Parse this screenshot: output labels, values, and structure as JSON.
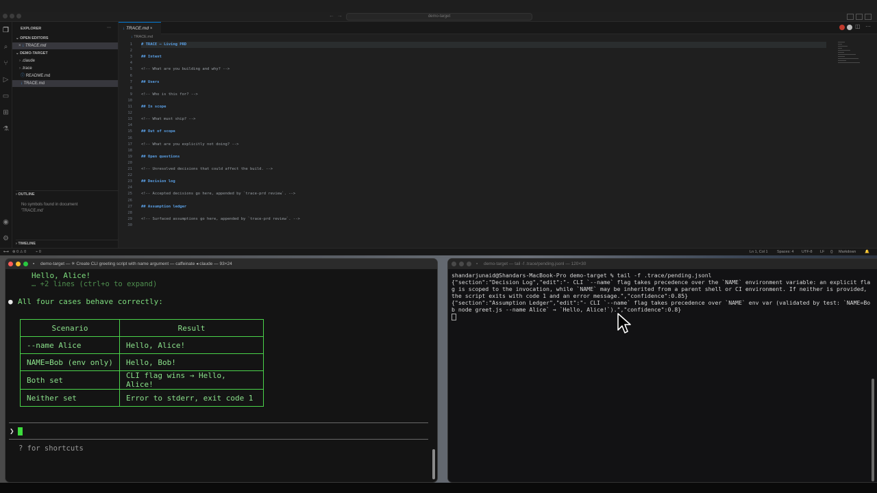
{
  "vscode": {
    "search_label": "demo-target",
    "activity_icons": [
      "files-icon",
      "search-icon",
      "source-control-icon",
      "run-debug-icon",
      "remote-explorer-icon",
      "extensions-icon",
      "testing-icon",
      "account-icon",
      "gear-icon"
    ],
    "sidebar": {
      "explorer_title": "EXPLORER",
      "open_editors_header": "OPEN EDITORS",
      "open_editors": [
        {
          "name": "TRACE.md"
        }
      ],
      "project_header": "DEMO-TARGET",
      "tree": [
        {
          "name": ".claude",
          "type": "folder"
        },
        {
          "name": ".trace",
          "type": "folder"
        },
        {
          "name": "README.md",
          "type": "file"
        },
        {
          "name": "TRACE.md",
          "type": "file",
          "selected": true
        }
      ],
      "outline_header": "OUTLINE",
      "outline_empty_line1": "No symbols found in document",
      "outline_empty_line2": "'TRACE.md'",
      "timeline_header": "TIMELINE"
    },
    "editor": {
      "tab_label": "TRACE.md",
      "tab_close": "×",
      "breadcrumb": "TRACE.md",
      "lines": [
        {
          "n": "1",
          "text": "# TRACE — Living PRD",
          "kind": "h"
        },
        {
          "n": "2",
          "text": "",
          "kind": "t"
        },
        {
          "n": "3",
          "text": "## Intent",
          "kind": "h"
        },
        {
          "n": "4",
          "text": "",
          "kind": "t"
        },
        {
          "n": "5",
          "text": "<!-- What are you building and why? -->",
          "kind": "t"
        },
        {
          "n": "6",
          "text": "",
          "kind": "t"
        },
        {
          "n": "7",
          "text": "## Users",
          "kind": "h"
        },
        {
          "n": "8",
          "text": "",
          "kind": "t"
        },
        {
          "n": "9",
          "text": "<!-- Who is this for? -->",
          "kind": "t"
        },
        {
          "n": "10",
          "text": "",
          "kind": "t"
        },
        {
          "n": "11",
          "text": "## In scope",
          "kind": "h"
        },
        {
          "n": "12",
          "text": "",
          "kind": "t"
        },
        {
          "n": "13",
          "text": "<!-- What must ship? -->",
          "kind": "t"
        },
        {
          "n": "14",
          "text": "",
          "kind": "t"
        },
        {
          "n": "15",
          "text": "## Out of scope",
          "kind": "h"
        },
        {
          "n": "16",
          "text": "",
          "kind": "t"
        },
        {
          "n": "17",
          "text": "<!-- What are you explicitly not doing? -->",
          "kind": "t"
        },
        {
          "n": "18",
          "text": "",
          "kind": "t"
        },
        {
          "n": "19",
          "text": "## Open questions",
          "kind": "h"
        },
        {
          "n": "20",
          "text": "",
          "kind": "t"
        },
        {
          "n": "21",
          "text": "<!-- Unresolved decisions that could affect the build. -->",
          "kind": "t"
        },
        {
          "n": "22",
          "text": "",
          "kind": "t"
        },
        {
          "n": "23",
          "text": "## Decision log",
          "kind": "h"
        },
        {
          "n": "24",
          "text": "",
          "kind": "t"
        },
        {
          "n": "25",
          "text": "<!-- Accepted decisions go here, appended by `trace-prd review`. -->",
          "kind": "t"
        },
        {
          "n": "26",
          "text": "",
          "kind": "t"
        },
        {
          "n": "27",
          "text": "## Assumption ledger",
          "kind": "h"
        },
        {
          "n": "28",
          "text": "",
          "kind": "t"
        },
        {
          "n": "29",
          "text": "<!-- Surfaced assumptions go here, appended by `trace-prd review`. -->",
          "kind": "t"
        },
        {
          "n": "30",
          "text": "",
          "kind": "t"
        }
      ]
    },
    "statusbar": {
      "problems": "⊗ 0 ⚠ 0",
      "ports": "⌁ 0",
      "position": "Ln 1, Col 1",
      "spaces": "Spaces: 4",
      "encoding": "UTF-8",
      "eol": "LF",
      "braces": "{}",
      "language": "Markdown"
    }
  },
  "term_left": {
    "title": "demo-target — ✳ Create CLI greeting script with name argument — caffeinate ◂ claude — 93×24",
    "lines": {
      "hello": "Hello, Alice!",
      "more": "… +2 lines (ctrl+o to expand)",
      "bullet": "●",
      "summary": "All four cases behave correctly:"
    },
    "table": {
      "headers": [
        "Scenario",
        "Result"
      ],
      "rows": [
        [
          "--name Alice",
          "Hello, Alice!"
        ],
        [
          "NAME=Bob (env only)",
          "Hello, Bob!"
        ],
        [
          "Both set",
          "CLI flag wins → Hello, Alice!"
        ],
        [
          "Neither set",
          "Error to stderr, exit code 1"
        ]
      ]
    },
    "prompt_symbol": "❯",
    "shortcuts_hint": "? for shortcuts"
  },
  "term_right": {
    "title": "demo-target — tail -f .trace/pending.jsonl — 120×30",
    "command": "shandarjunaid@Shandars-MacBook-Pro demo-target % tail -f .trace/pending.jsonl",
    "output": [
      "{\"section\":\"Decision Log\",\"edit\":\"- CLI `--name` flag takes precedence over the `NAME` environment variable: an explicit flag is scoped to the invocation, while `NAME` may be inherited from a parent shell or CI environment. If neither is provided, the script exits with code 1 and an error message.\",\"confidence\":0.85}",
      "{\"section\":\"Assumption Ledger\",\"edit\":\"- CLI `--name` flag takes precedence over `NAME` env var (validated by test: `NAME=Bob node greet.js --name Alice` → `Hello, Alice!`).\",\"confidence\":0.8}"
    ]
  }
}
